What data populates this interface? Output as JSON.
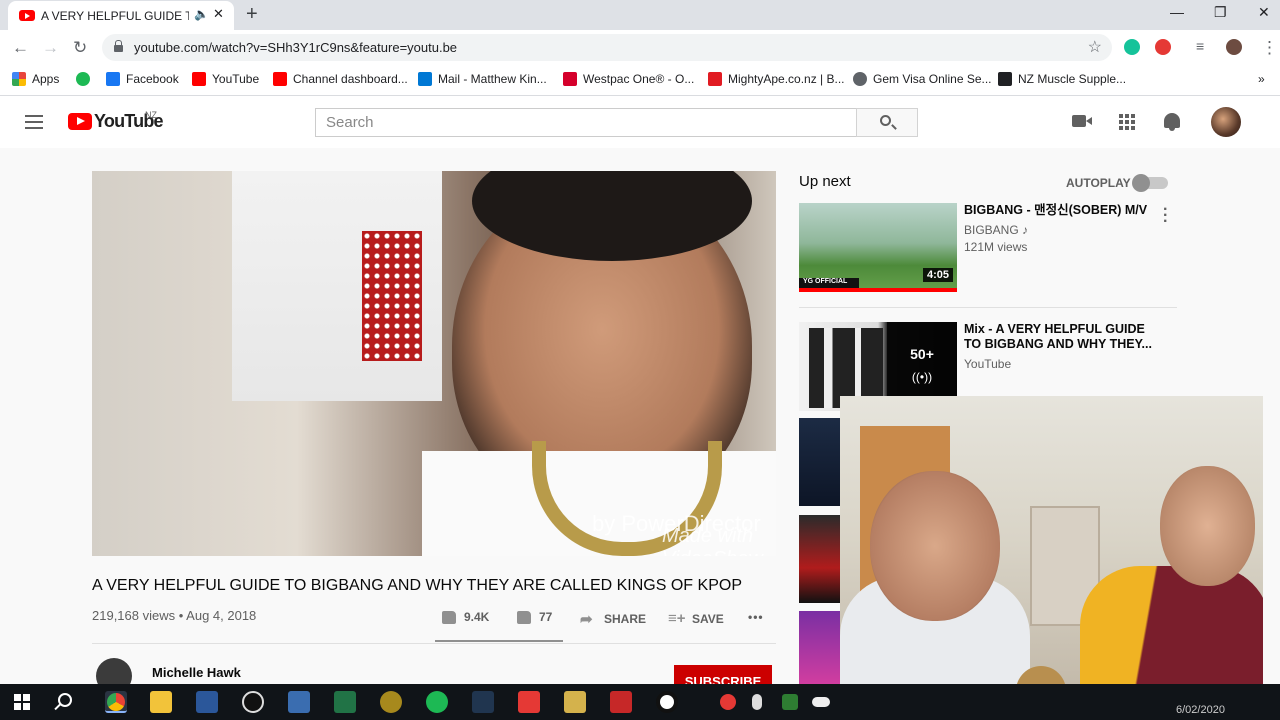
{
  "browser": {
    "tab_title": "A VERY HELPFUL GUIDE TO BIGBANG",
    "tab_audio_icon": "speaker-icon",
    "tab_close": "✕",
    "new_tab": "+",
    "window_controls": {
      "minimize": "—",
      "maximize": "❐",
      "close": "✕"
    },
    "url": "youtube.com/watch?v=SHh3Y1rC9ns&feature=youtu.be",
    "bookmarks": [
      {
        "label": "Apps",
        "color": "#e8453c"
      },
      {
        "label": "",
        "color": "#1db954"
      },
      {
        "label": "Facebook",
        "color": "#1877f2"
      },
      {
        "label": "YouTube",
        "color": "#ff0000"
      },
      {
        "label": "Channel dashboard...",
        "color": "#ff0000"
      },
      {
        "label": "Mail - Matthew Kin...",
        "color": "#0078d4"
      },
      {
        "label": "Westpac One® - O...",
        "color": "#d5002b"
      },
      {
        "label": "MightyApe.co.nz | B...",
        "color": "#e11b22"
      },
      {
        "label": "Gem Visa Online Se...",
        "color": "#5f6368"
      },
      {
        "label": "NZ Muscle Supple...",
        "color": "#202124"
      }
    ],
    "bookmarks_more": "»"
  },
  "youtube": {
    "logo_text": "YouTube",
    "country": "NZ",
    "search_placeholder": "Search",
    "video": {
      "watermark_line1": "by PowerDirector",
      "watermark_line2": "Made with VideoShow",
      "title": "A VERY HELPFUL GUIDE TO BIGBANG AND WHY THEY ARE CALLED KINGS OF KPOP",
      "meta": "219,168 views • Aug 4, 2018",
      "likes": "9.4K",
      "dislikes": "77",
      "share": "SHARE",
      "save": "SAVE",
      "more": "•••",
      "channel": "Michelle Hawk",
      "subscribe": "SUBSCRIBE"
    },
    "sidebar": {
      "heading": "Up next",
      "autoplay": "AUTOPLAY",
      "items": [
        {
          "title": "BIGBANG - 맨정신(SOBER) M/V",
          "channel": "BIGBANG ♪",
          "views": "121M views",
          "duration": "4:05"
        },
        {
          "title": "Mix - A VERY HELPFUL GUIDE TO BIGBANG AND WHY THEY...",
          "channel": "YouTube",
          "count": "50+",
          "live": "((•))"
        }
      ]
    }
  },
  "taskbar": {
    "clock": "6/02/2020"
  }
}
